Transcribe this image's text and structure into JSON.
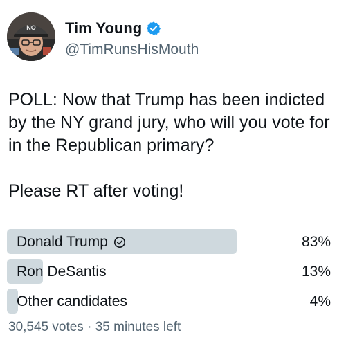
{
  "author": {
    "display_name": "Tim Young",
    "handle": "@TimRunsHisMouth",
    "verified": true,
    "avatar_hat_text": "NO"
  },
  "tweet": {
    "text": "POLL: Now that Trump has been indicted by the NY grand jury, who will you vote for in the Republican primary?",
    "cta": "Please RT after voting!"
  },
  "poll": {
    "options": [
      {
        "label": "Donald Trump",
        "percent_label": "83%",
        "percent": 83,
        "winner": true
      },
      {
        "label": "Ron DeSantis",
        "percent_label": "13%",
        "percent": 13,
        "winner": false
      },
      {
        "label": "Other candidates",
        "percent_label": "4%",
        "percent": 4,
        "winner": false
      }
    ],
    "votes": "30,545 votes",
    "separator": "·",
    "time_left": "35 minutes left"
  },
  "colors": {
    "verified": "#1d9bf0",
    "bar": "#cfd9de",
    "muted_text": "#536471",
    "text": "#0f1419"
  },
  "icons": {
    "verified": "verified-badge-icon",
    "winner": "check-circle-icon"
  }
}
